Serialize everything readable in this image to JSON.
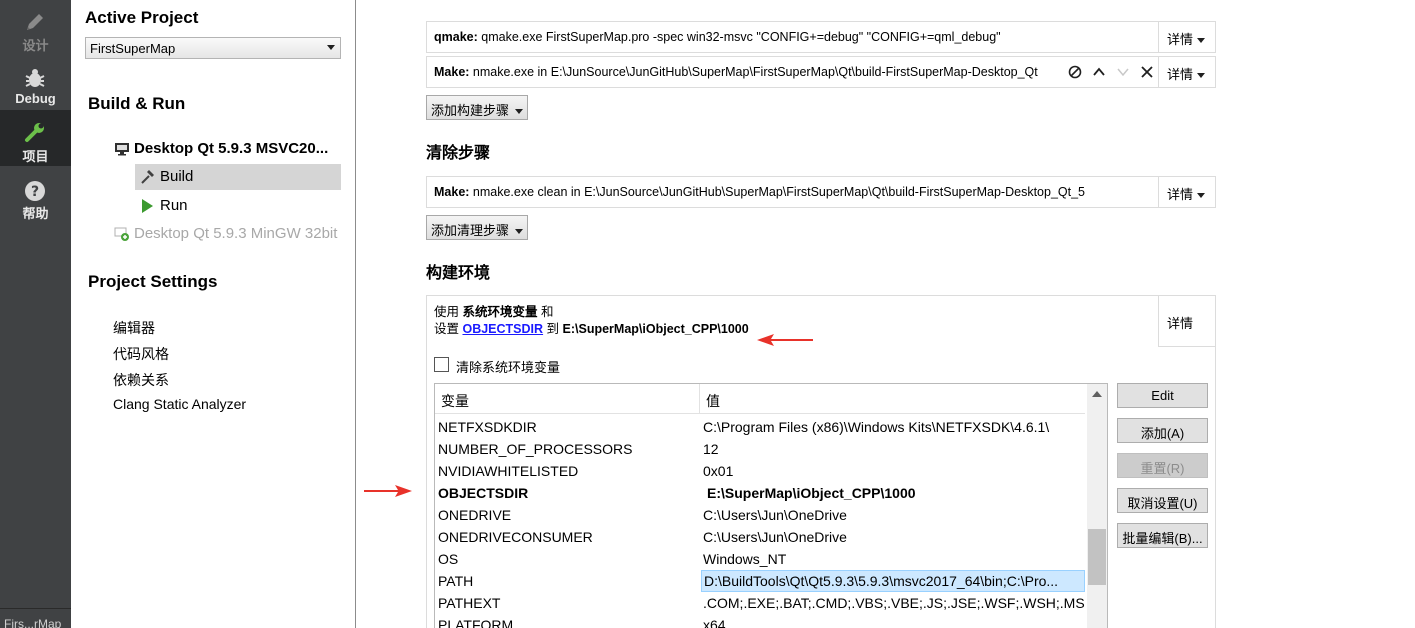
{
  "modebar": {
    "items": [
      {
        "label": "设计",
        "icon": "pencil-icon",
        "state": "disabled"
      },
      {
        "label": "Debug",
        "icon": "bug-icon",
        "state": "normal"
      },
      {
        "label": "项目",
        "icon": "wrench-icon",
        "state": "active"
      },
      {
        "label": "帮助",
        "icon": "help-icon",
        "state": "normal"
      }
    ],
    "bottom_label": "Firs...rMap"
  },
  "nav": {
    "active_project_heading": "Active Project",
    "active_project_value": "FirstSuperMap",
    "build_run_heading": "Build & Run",
    "kits": [
      {
        "label": "Desktop Qt 5.9.3 MSVC20...",
        "icon": "monitor-icon",
        "enabled": true
      },
      {
        "label": "Desktop Qt 5.9.3 MinGW 32bit",
        "icon": "add-kit-icon",
        "enabled": false
      }
    ],
    "build_label": "Build",
    "run_label": "Run",
    "project_settings_heading": "Project Settings",
    "settings_items": [
      "编辑器",
      "代码风格",
      "依赖关系",
      "Clang Static Analyzer"
    ]
  },
  "main": {
    "build_steps": [
      {
        "prefix": "qmake:",
        "text": " qmake.exe FirstSuperMap.pro -spec win32-msvc \"CONFIG+=debug\" \"CONFIG+=qml_debug\"",
        "details": "详情"
      },
      {
        "prefix": "Make:",
        "text": " nmake.exe in E:\\JunSource\\JunGitHub\\SuperMap\\FirstSuperMap\\Qt\\build-FirstSuperMap-Desktop_Qt",
        "details": "详情"
      }
    ],
    "add_build_step": "添加构建步骤",
    "clean_title": "清除步骤",
    "clean_steps": [
      {
        "prefix": "Make:",
        "text": " nmake.exe clean in E:\\JunSource\\JunGitHub\\SuperMap\\FirstSuperMap\\Qt\\build-FirstSuperMap-Desktop_Qt_5",
        "details": "详情"
      }
    ],
    "add_clean_step": "添加清理步骤",
    "env_title": "构建环境",
    "env_summary": {
      "line1_prefix": "使用 ",
      "line1_bold": "系统环境变量",
      "line1_suffix": " 和",
      "line2_prefix": "设置 ",
      "line2_link": "OBJECTSDIR",
      "line2_mid": " 到 ",
      "line2_bold": "E:\\SuperMap\\iObject_CPP\\1000"
    },
    "env_details": "详情",
    "clear_env_label": "清除系统环境变量",
    "clear_env_checked": false,
    "table_headers": {
      "variable": "变量",
      "value": "值"
    },
    "env_rows": [
      {
        "name": "NETFXSDKDIR",
        "value": "C:\\Program Files (x86)\\Windows Kits\\NETFXSDK\\4.6.1\\",
        "bold": false,
        "selected": false
      },
      {
        "name": "NUMBER_OF_PROCESSORS",
        "value": "12",
        "bold": false,
        "selected": false
      },
      {
        "name": "NVIDIAWHITELISTED",
        "value": "0x01",
        "bold": false,
        "selected": false
      },
      {
        "name": "OBJECTSDIR",
        "value": "E:\\SuperMap\\iObject_CPP\\1000",
        "bold": true,
        "selected": false
      },
      {
        "name": "ONEDRIVE",
        "value": "C:\\Users\\Jun\\OneDrive",
        "bold": false,
        "selected": false
      },
      {
        "name": "ONEDRIVECONSUMER",
        "value": "C:\\Users\\Jun\\OneDrive",
        "bold": false,
        "selected": false
      },
      {
        "name": "OS",
        "value": "Windows_NT",
        "bold": false,
        "selected": false
      },
      {
        "name": "PATH",
        "value": "D:\\BuildTools\\Qt\\Qt5.9.3\\5.9.3\\msvc2017_64\\bin;C:\\Pro...",
        "bold": false,
        "selected": true
      },
      {
        "name": "PATHEXT",
        "value": ".COM;.EXE;.BAT;.CMD;.VBS;.VBE;.JS;.JSE;.WSF;.WSH;.MSC;...",
        "bold": false,
        "selected": false
      },
      {
        "name": "PLATFORM",
        "value": "x64",
        "bold": false,
        "selected": false
      }
    ],
    "side_buttons": [
      {
        "label": "Edit",
        "enabled": true
      },
      {
        "label": "添加(A)",
        "enabled": true
      },
      {
        "label": "重置(R)",
        "enabled": false
      },
      {
        "label": "取消设置(U)",
        "enabled": true
      },
      {
        "label": "批量编辑(B)...",
        "enabled": true
      }
    ]
  },
  "colors": {
    "modebar_bg": "#404244",
    "modebar_active": "#262829",
    "run_green": "#3c9a2f",
    "annotation_red": "#e8322a",
    "link_blue": "#1a1aff",
    "selection": "#cde8ff"
  }
}
